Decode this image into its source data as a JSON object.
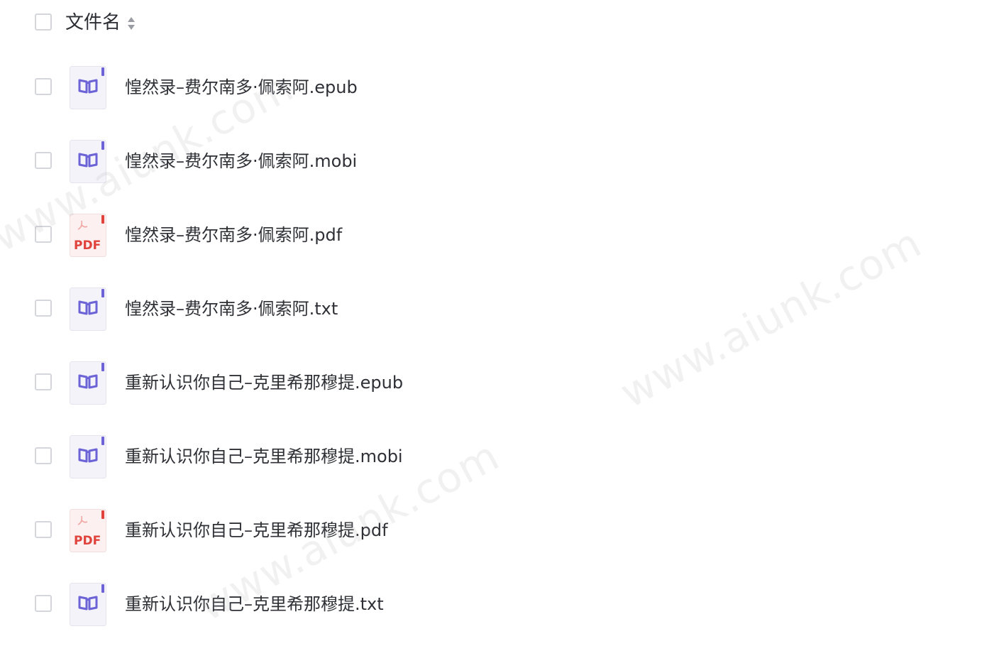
{
  "header": {
    "column_label": "文件名",
    "sort_icon": "sort-updown-icon"
  },
  "files": [
    {
      "name": "惶然录–费尔南多·佩索阿.epub",
      "icon": "book-icon"
    },
    {
      "name": "惶然录–费尔南多·佩索阿.mobi",
      "icon": "book-icon"
    },
    {
      "name": "惶然录–费尔南多·佩索阿.pdf",
      "icon": "pdf-icon"
    },
    {
      "name": "惶然录–费尔南多·佩索阿.txt",
      "icon": "book-icon"
    },
    {
      "name": "重新认识你自己–克里希那穆提.epub",
      "icon": "book-icon"
    },
    {
      "name": "重新认识你自己–克里希那穆提.mobi",
      "icon": "book-icon"
    },
    {
      "name": "重新认识你自己–克里希那穆提.pdf",
      "icon": "pdf-icon"
    },
    {
      "name": "重新认识你自己–克里希那穆提.txt",
      "icon": "book-icon"
    }
  ],
  "pdf_icon_label": "PDF",
  "watermark": "www.aiunk.com",
  "colors": {
    "book_icon_bg": "#f3f3f9",
    "book_icon_accent": "#6b63d6",
    "pdf_icon_bg": "#fcf0f0",
    "pdf_icon_accent": "#e0423c"
  }
}
